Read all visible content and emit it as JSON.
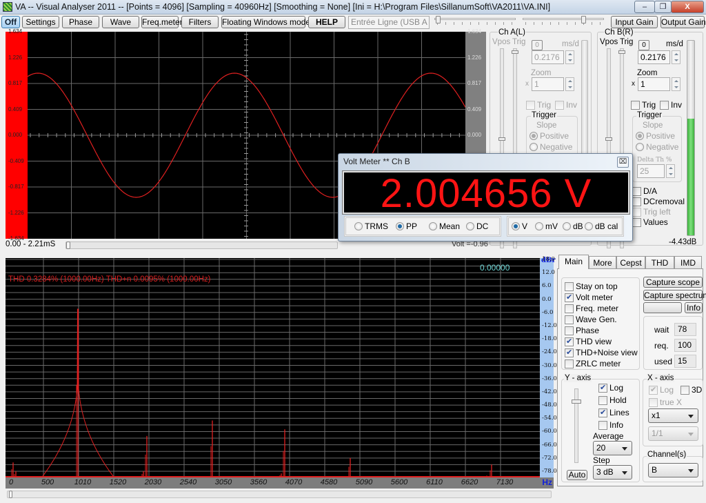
{
  "window": {
    "title": "VA -- Visual Analyser 2011 --  [Points = 4096]  [Sampling = 40960Hz]  [Smoothing = None]  [Ini = H:\\Program Files\\SillanumSoft\\VA2011\\VA.INI]",
    "controls": {
      "minimize": "–",
      "maximize": "❐",
      "close": "X"
    }
  },
  "toolbar": {
    "buttons": [
      "Off",
      "Settings",
      "Phase",
      "Wave",
      "Freq.meter",
      "Filters",
      "Floating Windows mode",
      "HELP"
    ],
    "input_device": "Entrée Ligne (USB A",
    "input_gain_label": "Input Gain",
    "output_gain_label": "Output Gain",
    "slider_a_value": 0,
    "slider_b_value": 0.72
  },
  "scope": {
    "y_ticks": [
      "1.634",
      "1.226",
      "0.817",
      "0.409",
      "0.000",
      "-0.409",
      "-0.817",
      "-1.226",
      "-1.634"
    ],
    "time_range": "0.00 - 2.21mS",
    "volt_readout": "Volt =-0.96",
    "colors": {
      "trace": "#e02020",
      "left_axis": "#ff0000",
      "right_axis": "#808080"
    }
  },
  "chA": {
    "title": "Ch A(L)",
    "vpos_label": "Vpos",
    "trig_label": "Trig",
    "zero_btn": "0",
    "ms_label": "ms/d",
    "ms_value": "0.2176",
    "zoom_label": "Zoom",
    "zoom_x": "x",
    "zoom_value": "1",
    "trig_cb": "Trig",
    "inv_cb": "Inv",
    "trigger_group": "Trigger",
    "slope_label": "Slope",
    "positive": "Positive",
    "negative": "Negative"
  },
  "chB": {
    "title": "Ch B(R)",
    "vpos_label": "Vpos",
    "trig_label": "Trig",
    "zero_btn": "0",
    "ms_label": "ms/d",
    "ms_value": "0.2176",
    "zoom_label": "Zoom",
    "zoom_x": "x",
    "zoom_value": "1",
    "trig_cb": "Trig",
    "inv_cb": "Inv",
    "trigger_group": "Trigger",
    "slope_label": "Slope",
    "positive": "Positive",
    "negative": "Negative",
    "delta_th_label": "Delta Th %",
    "delta_th_value": "25",
    "da": "D/A",
    "dcremoval": "DCremoval",
    "trig_left": "Trig left",
    "values": "Values",
    "level_db": "-4.43dB",
    "level_fraction": 0.6
  },
  "volt_meter": {
    "title": "Volt Meter ** Ch B",
    "value": "2.004656 V",
    "modes": [
      {
        "label": "TRMS",
        "on": false
      },
      {
        "label": "PP",
        "on": true
      },
      {
        "label": "Mean",
        "on": false
      },
      {
        "label": "DC",
        "on": false
      }
    ],
    "units": [
      {
        "label": "V",
        "on": true
      },
      {
        "label": "mV",
        "on": false
      },
      {
        "label": "dB",
        "on": false
      },
      {
        "label": "dB cal",
        "on": false
      }
    ],
    "close": "⌧"
  },
  "spectrum": {
    "thd_text": "THD 0.3284% (1000.00Hz) THD+n 0.0095% (1000.00Hz)",
    "cursor_value": "0.00000",
    "y_unit": "dBr",
    "x_unit": "Hz",
    "y_ticks": [
      "18.0",
      "12.0",
      "6.0",
      "0.0",
      "-6.0",
      "-12.0",
      "-18.0",
      "-24.0",
      "-30.0",
      "-36.0",
      "-42.0",
      "-48.0",
      "-54.0",
      "-60.0",
      "-66.0",
      "-72.0",
      "-78.0"
    ],
    "x_ticks": [
      "0",
      "500",
      "1010",
      "1520",
      "2030",
      "2540",
      "3050",
      "3560",
      "4070",
      "4580",
      "5090",
      "5600",
      "6110",
      "6620",
      "7130"
    ],
    "peaks_db": [
      {
        "hz": 60,
        "db": -74
      },
      {
        "hz": 100,
        "db": -78
      },
      {
        "hz": 1000,
        "db": -4.5
      },
      {
        "hz": 1950,
        "db": -78
      },
      {
        "hz": 2000,
        "db": -62
      },
      {
        "hz": 2950,
        "db": -55
      },
      {
        "hz": 3950,
        "db": -79
      },
      {
        "hz": 4000,
        "db": -59
      },
      {
        "hz": 4950,
        "db": -72
      },
      {
        "hz": 5150,
        "db": -82
      },
      {
        "hz": 6930,
        "db": -80
      },
      {
        "hz": 7000,
        "db": -75
      }
    ],
    "trace_color": "#e02020"
  },
  "tabs": [
    "Main",
    "More",
    "Cepst",
    "THD",
    "IMD"
  ],
  "main_tab": {
    "options": [
      {
        "label": "Stay on top",
        "checked": false
      },
      {
        "label": "Volt meter",
        "checked": true
      },
      {
        "label": "Freq. meter",
        "checked": false
      },
      {
        "label": "Wave Gen.",
        "checked": false
      },
      {
        "label": "Phase",
        "checked": false
      },
      {
        "label": "THD view",
        "checked": true
      },
      {
        "label": "THD+Noise view",
        "checked": true
      },
      {
        "label": "ZRLC meter",
        "checked": false
      }
    ],
    "capture_scope": "Capture scope",
    "capture_spectrum": "Capture spectrum",
    "info_btn": "Info",
    "wait_label": "wait",
    "wait_value": "78",
    "req_label": "req.",
    "req_value": "100",
    "used_label": "used",
    "used_value": "15",
    "y_axis": {
      "title": "Y - axis",
      "log": {
        "label": "Log",
        "checked": true
      },
      "hold": {
        "label": "Hold",
        "checked": false
      },
      "lines": {
        "label": "Lines",
        "checked": true
      },
      "info": {
        "label": "Info",
        "checked": false
      },
      "average_label": "Average",
      "average_value": "20",
      "step_label": "Step",
      "step_value": "3 dB",
      "auto_btn": "Auto"
    },
    "x_axis": {
      "title": "X - axis",
      "log": {
        "label": "Log",
        "checked": true
      },
      "three_d": {
        "label": "3D",
        "checked": false
      },
      "true_x": {
        "label": "true X",
        "checked": false
      },
      "zoom_value": "x1",
      "ratio_value": "1/1"
    },
    "channels": {
      "title": "Channel(s)",
      "value": "B"
    }
  }
}
